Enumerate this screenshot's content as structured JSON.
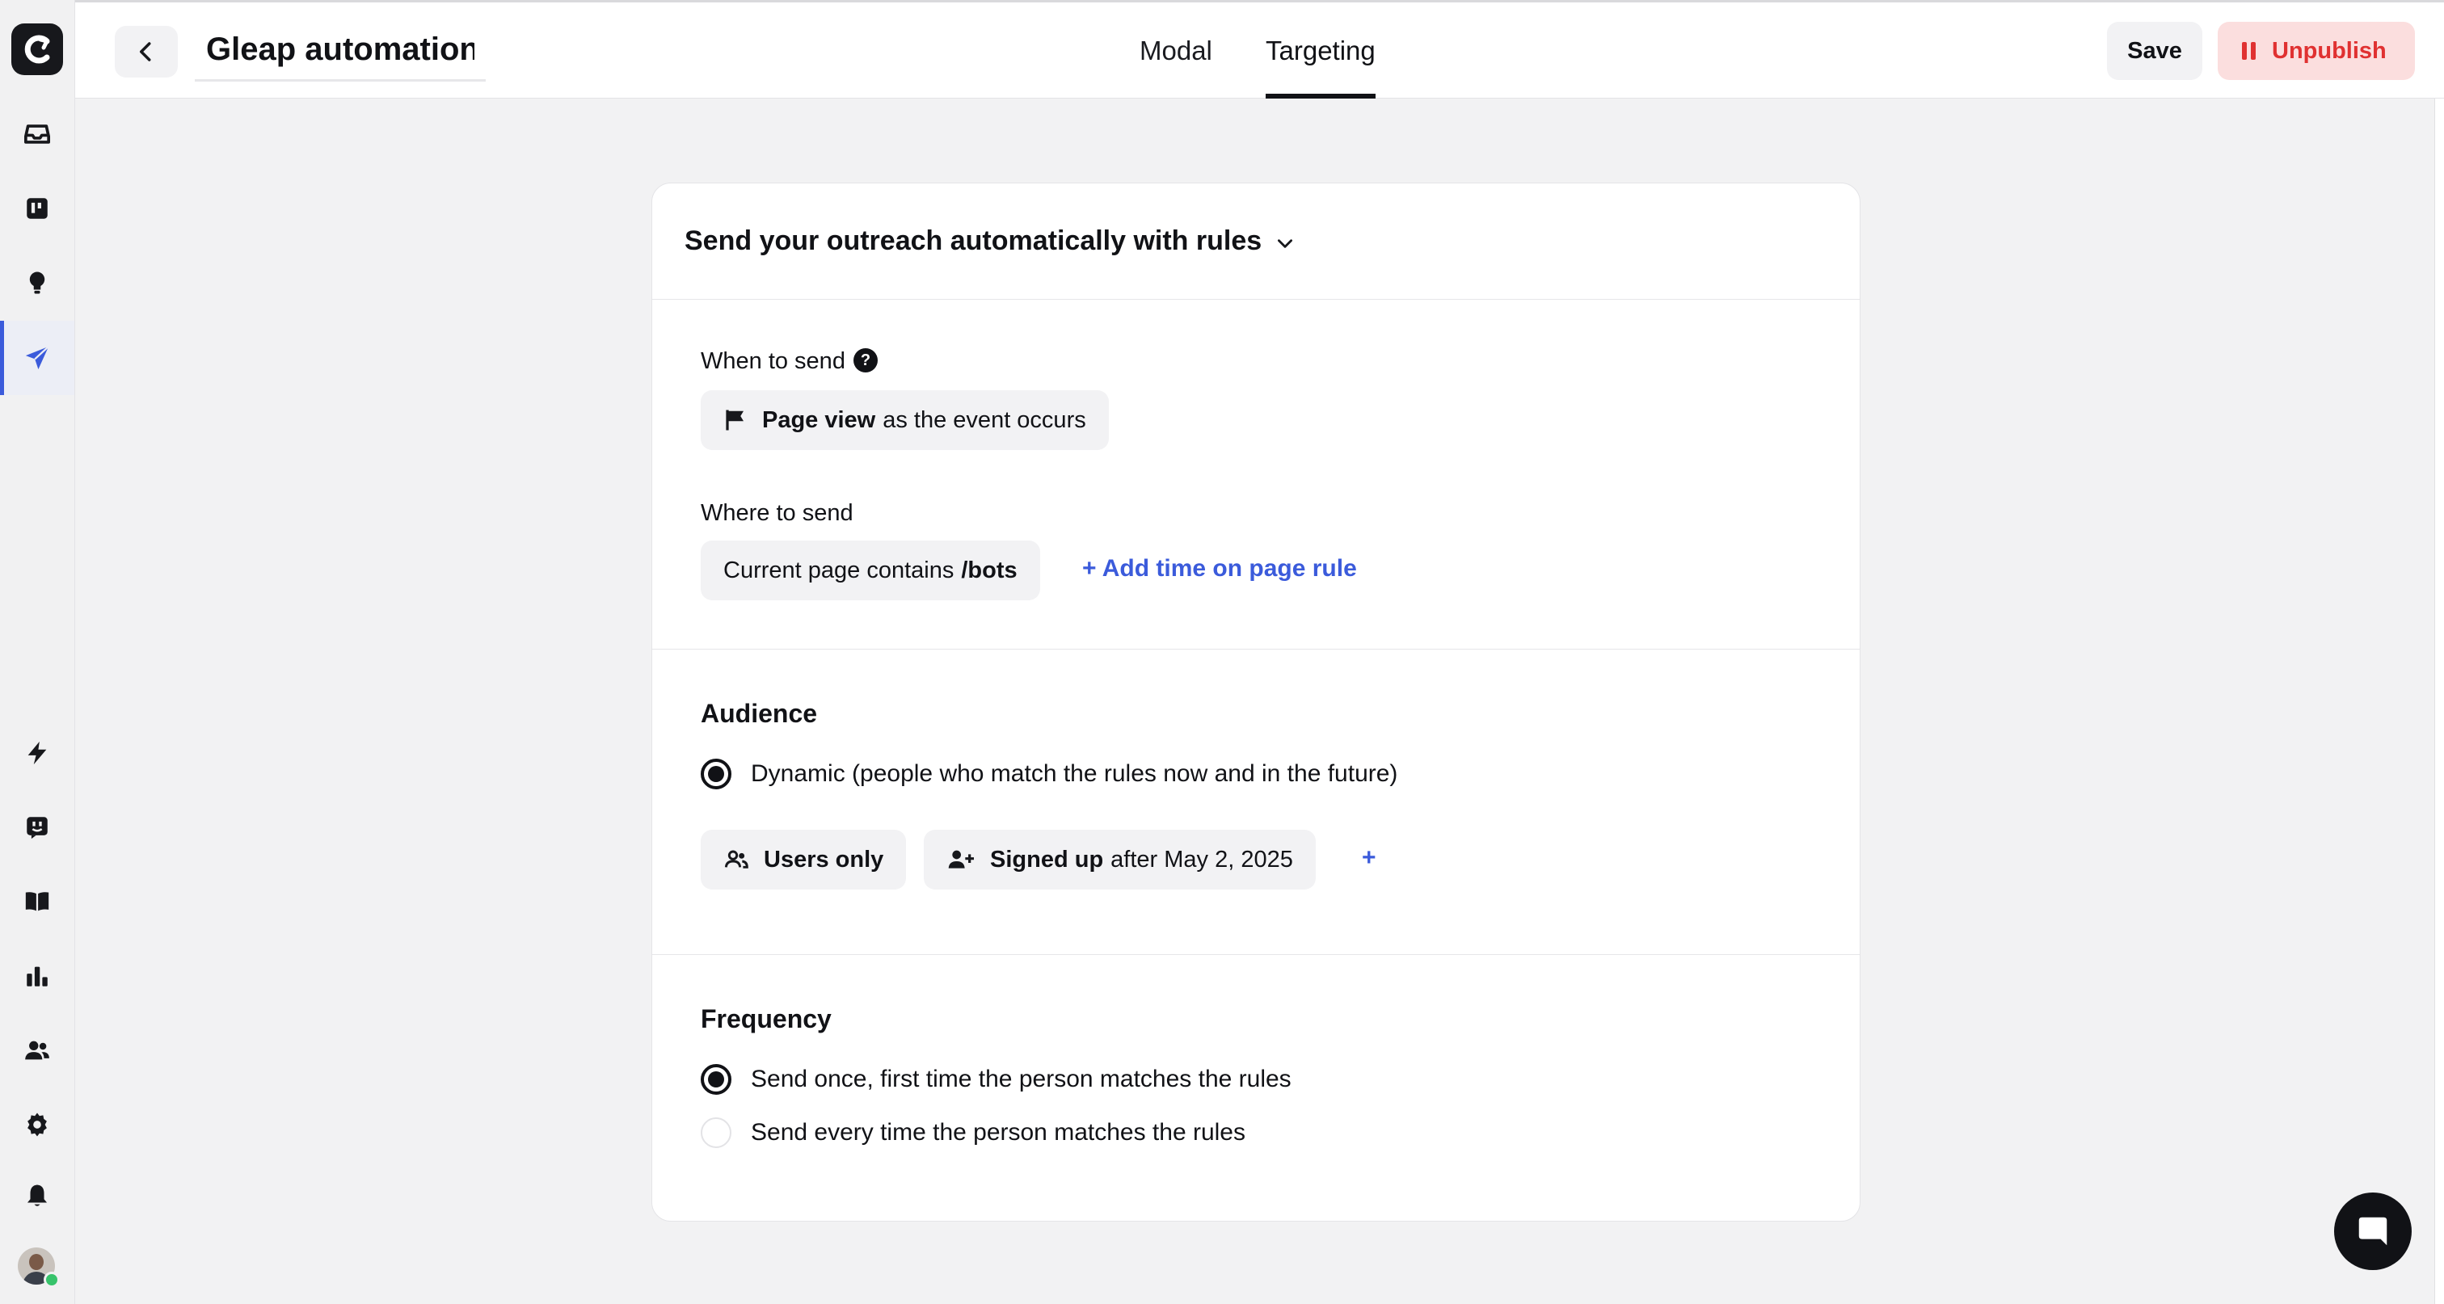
{
  "header": {
    "title_value": "Gleap automation",
    "tabs": [
      {
        "label": "Modal",
        "active": false
      },
      {
        "label": "Targeting",
        "active": true
      }
    ],
    "save_label": "Save",
    "unpublish_label": "Unpublish"
  },
  "sidebar": {
    "items": [
      {
        "icon": "inbox-icon"
      },
      {
        "icon": "board-icon"
      },
      {
        "icon": "lightbulb-icon"
      },
      {
        "icon": "paper-plane-icon",
        "active": true
      },
      {
        "icon": "bolt-icon"
      },
      {
        "icon": "bot-icon"
      },
      {
        "icon": "book-icon"
      },
      {
        "icon": "bar-chart-icon"
      },
      {
        "icon": "users-icon"
      },
      {
        "icon": "gear-icon"
      },
      {
        "icon": "bell-icon"
      }
    ],
    "user_status": "online"
  },
  "card": {
    "title": "Send your outreach automatically with rules",
    "when": {
      "label": "When to send",
      "help_symbol": "?",
      "event_name": "Page view",
      "event_suffix": "as the event occurs"
    },
    "where": {
      "label": "Where to send",
      "rule_prefix": "Current page contains",
      "rule_value": "/bots",
      "add_rule_label": "+ Add time on page rule"
    },
    "audience": {
      "heading": "Audience",
      "option": "Dynamic (people who match the rules now and in the future)",
      "filters": [
        {
          "bold": "Users only",
          "rest": ""
        },
        {
          "bold": "Signed up",
          "rest": "after May 2, 2025"
        }
      ],
      "add_filter_label": "+"
    },
    "frequency": {
      "heading": "Frequency",
      "options": [
        {
          "label": "Send once, first time the person matches the rules",
          "selected": true
        },
        {
          "label": "Send every time the person matches the rules",
          "selected": false
        }
      ]
    }
  },
  "colors": {
    "accent": "#3b5bdb",
    "danger": "#e03131",
    "danger_bg": "#fbdede"
  }
}
